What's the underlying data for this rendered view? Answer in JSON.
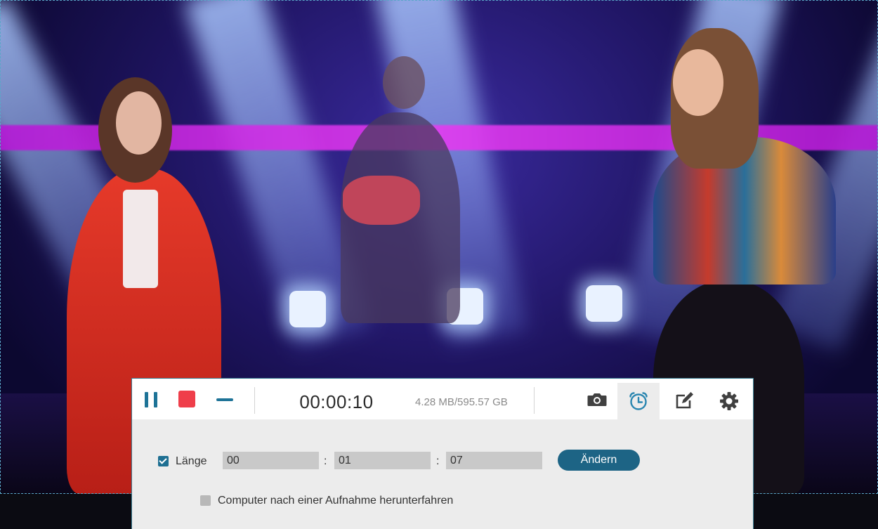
{
  "video": {
    "description_icon": "stage-performance-image"
  },
  "recorder": {
    "timer": "00:00:10",
    "filesize": "4.28 MB/595.57 GB",
    "icons": {
      "pause": "pause-icon",
      "stop": "stop-icon",
      "minimize": "minimize-icon",
      "camera": "camera-icon",
      "alarm": "alarm-clock-icon",
      "edit": "edit-icon",
      "settings": "gear-icon"
    },
    "length": {
      "checked": true,
      "label": "Länge",
      "hours": "00",
      "minutes": "01",
      "seconds": "07",
      "separator": ":",
      "change_label": "Ändern"
    },
    "shutdown": {
      "checked": false,
      "label": "Computer nach einer Aufnahme herunterfahren"
    },
    "colors": {
      "accent": "#1e7397",
      "stop": "#ef3e4a",
      "button": "#1d6485"
    }
  }
}
